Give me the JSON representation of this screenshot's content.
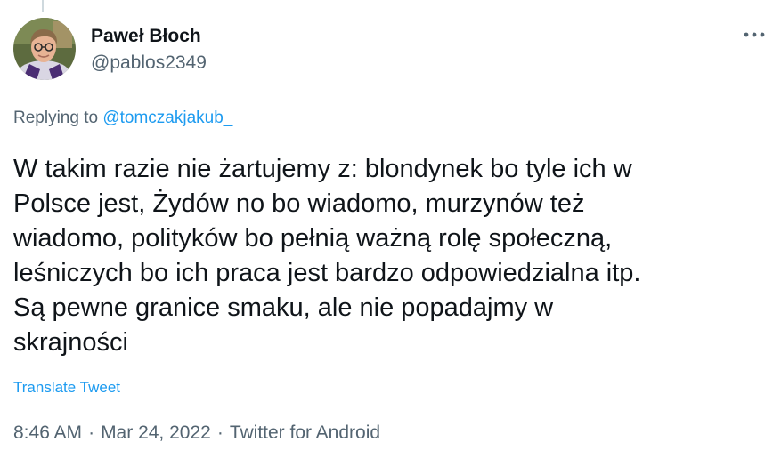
{
  "author": {
    "name": "Paweł Błoch",
    "handle": "@pablos2349",
    "avatar_icon": "profile-photo-icon"
  },
  "menu": {
    "more_icon": "more-options-icon"
  },
  "reply": {
    "prefix": "Replying to",
    "mention": "@tomczakjakub_"
  },
  "tweet": {
    "lines": [
      "W takim razie nie żartujemy z: blondynek bo tyle ich w",
      "Polsce jest, Żydów no bo wiadomo, murzynów też",
      "wiadomo, polityków bo pełnią ważną rolę społeczną,",
      "leśniczych bo ich praca jest bardzo odpowiedzialna itp.",
      "Są pewne granice smaku, ale nie popadajmy w",
      "skrajności"
    ],
    "translate_label": "Translate Tweet"
  },
  "meta": {
    "time": "8:46 AM",
    "separator": "·",
    "date": "Mar 24, 2022",
    "source": "Twitter for Android"
  },
  "colors": {
    "text": "#0f1419",
    "secondary": "#536471",
    "link": "#1d9bf0"
  }
}
